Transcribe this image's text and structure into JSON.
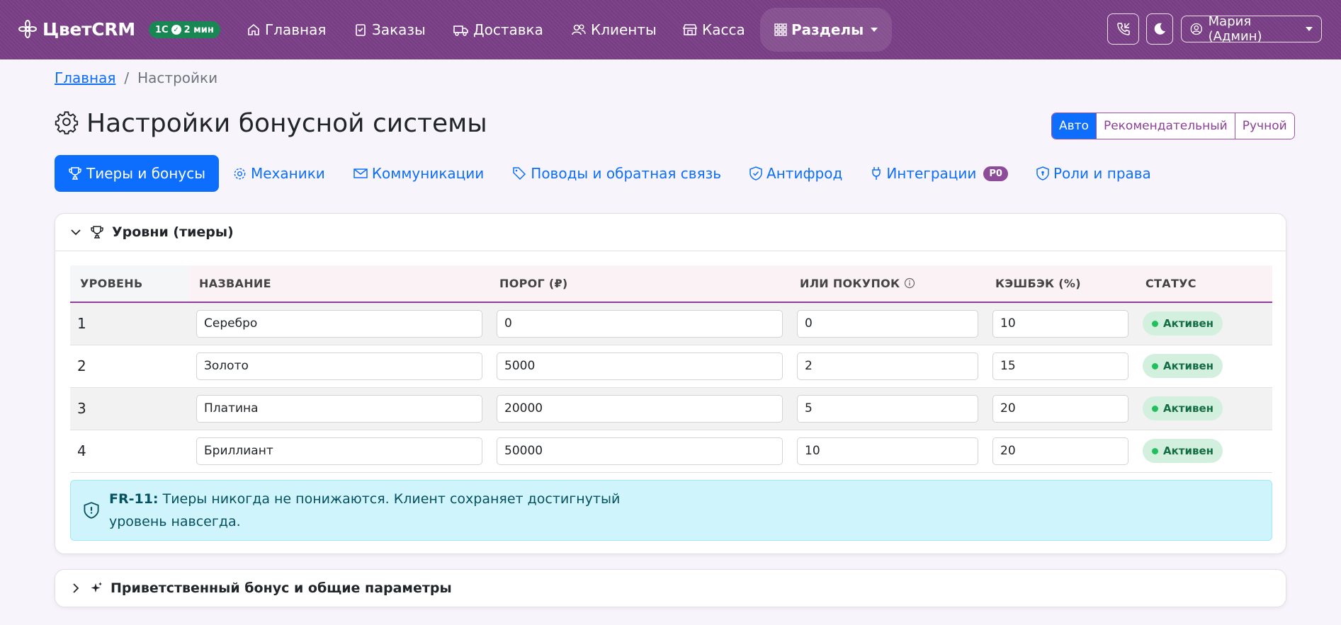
{
  "colors": {
    "nav_bg": "#7b3f86",
    "accent": "#0d6efd",
    "success": "#198754",
    "info_bg": "#cff4fc"
  },
  "brand": {
    "name": "ЦветCRM",
    "icon": "flower-icon"
  },
  "sync_badge": {
    "label": "1С",
    "time": "2 мин"
  },
  "nav": {
    "items": [
      {
        "label": "Главная",
        "icon": "home-icon"
      },
      {
        "label": "Заказы",
        "icon": "clipboard-icon"
      },
      {
        "label": "Доставка",
        "icon": "truck-icon"
      },
      {
        "label": "Клиенты",
        "icon": "users-icon"
      },
      {
        "label": "Касса",
        "icon": "shop-icon"
      },
      {
        "label": "Разделы",
        "icon": "grid-icon"
      }
    ],
    "user": "Мария (Админ)"
  },
  "breadcrumb": {
    "home": "Главная",
    "current": "Настройки"
  },
  "page": {
    "title": "Настройки бонусной системы"
  },
  "modes": [
    "Авто",
    "Рекомендательный",
    "Ручной"
  ],
  "tabs": [
    {
      "label": "Тиеры и бонусы",
      "icon": "trophy-icon"
    },
    {
      "label": "Механики",
      "icon": "gear-icon"
    },
    {
      "label": "Коммуникации",
      "icon": "envelope-icon"
    },
    {
      "label": "Поводы и обратная связь",
      "icon": "tag-icon"
    },
    {
      "label": "Антифрод",
      "icon": "shield-check-icon"
    },
    {
      "label": "Интеграции",
      "icon": "plug-icon",
      "badge": "P0"
    },
    {
      "label": "Роли и права",
      "icon": "shield-lock-icon"
    }
  ],
  "tiers_card": {
    "title": "Уровни (тиеры)",
    "columns": [
      "УРОВЕНЬ",
      "НАЗВАНИЕ",
      "ПОРОГ (₽)",
      "ИЛИ ПОКУПОК",
      "КЭШБЭК (%)",
      "СТАТУС"
    ],
    "rows": [
      {
        "level": "1",
        "name": "Серебро",
        "threshold": "0",
        "purchases": "0",
        "cashback": "10",
        "status": "Активен"
      },
      {
        "level": "2",
        "name": "Золото",
        "threshold": "5000",
        "purchases": "2",
        "cashback": "15",
        "status": "Активен"
      },
      {
        "level": "3",
        "name": "Платина",
        "threshold": "20000",
        "purchases": "5",
        "cashback": "20",
        "status": "Активен"
      },
      {
        "level": "4",
        "name": "Бриллиант",
        "threshold": "50000",
        "purchases": "10",
        "cashback": "20",
        "status": "Активен"
      }
    ],
    "alert": {
      "code": "FR-11:",
      "text": "Тиеры никогда не понижаются. Клиент сохраняет достигнутый уровень навсегда."
    }
  },
  "welcome_card": {
    "title": "Приветственный бонус и общие параметры"
  }
}
